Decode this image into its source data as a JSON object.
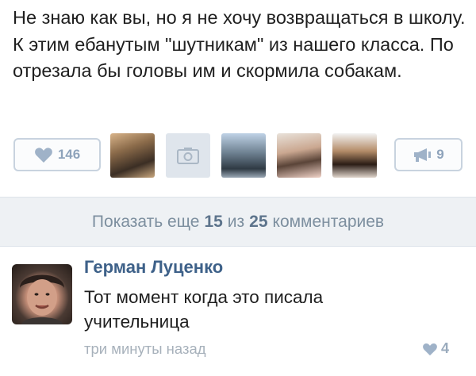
{
  "post": {
    "text": "Не знаю как вы, но я не хочу возвращаться в школу. К этим ебанутым \"шутникам\" из нашего класса. По отрезала бы головы им и скормила собакам."
  },
  "actions": {
    "like_count": "146",
    "share_count": "9"
  },
  "more_comments": {
    "prefix": "Показать еще",
    "shown": "15",
    "middle": "из",
    "total": "25",
    "suffix": "комментариев"
  },
  "comment": {
    "author": "Герман Луценко",
    "text": "Тот момент когда это писала учительница",
    "time": "три минуты назад",
    "like_count": "4"
  },
  "colors": {
    "link": "#3e6189",
    "muted": "#8ea3bb",
    "border": "#c8d3df"
  }
}
